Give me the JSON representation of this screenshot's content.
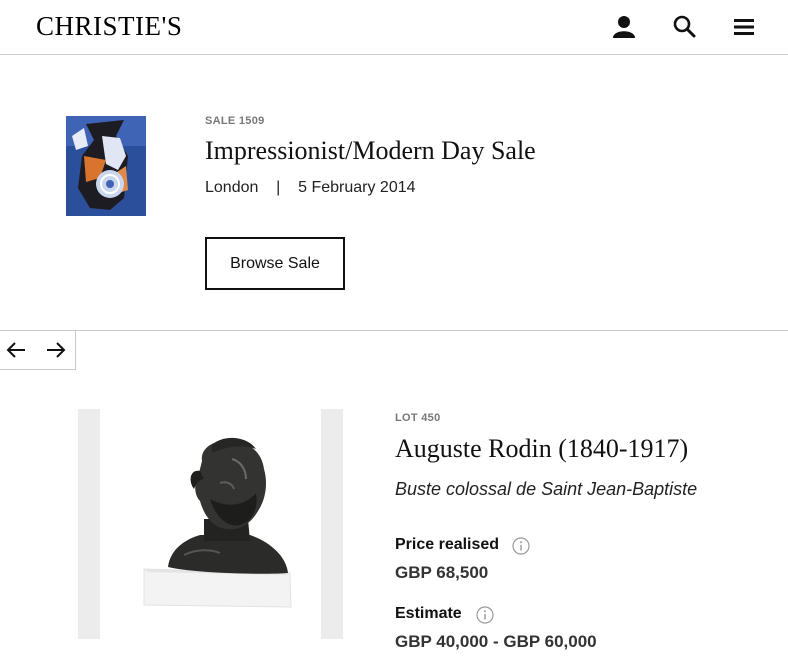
{
  "header": {
    "logo": "CHRISTIE'S",
    "icons": [
      "account-icon",
      "search-icon",
      "menu-icon"
    ]
  },
  "sale": {
    "label": "SALE 1509",
    "title": "Impressionist/Modern Day Sale",
    "location": "London",
    "separator": "|",
    "date": "5 February 2014",
    "browse_button": "Browse Sale"
  },
  "carousel": {
    "icons": [
      "arrow-left-icon",
      "arrow-right-icon"
    ]
  },
  "lot": {
    "label": "LOT 450",
    "title": "Auguste Rodin (1840-1917)",
    "subtitle": "Buste colossal de Saint Jean-Baptiste",
    "price_label": "Price realised",
    "price_value": "GBP 68,500",
    "estimate_label": "Estimate",
    "estimate_value": "GBP 40,000 - GBP 60,000"
  },
  "colors": {
    "text": "#111111",
    "muted": "#777777",
    "divider": "#c8c8c8",
    "image_backdrop": "#ececec"
  }
}
